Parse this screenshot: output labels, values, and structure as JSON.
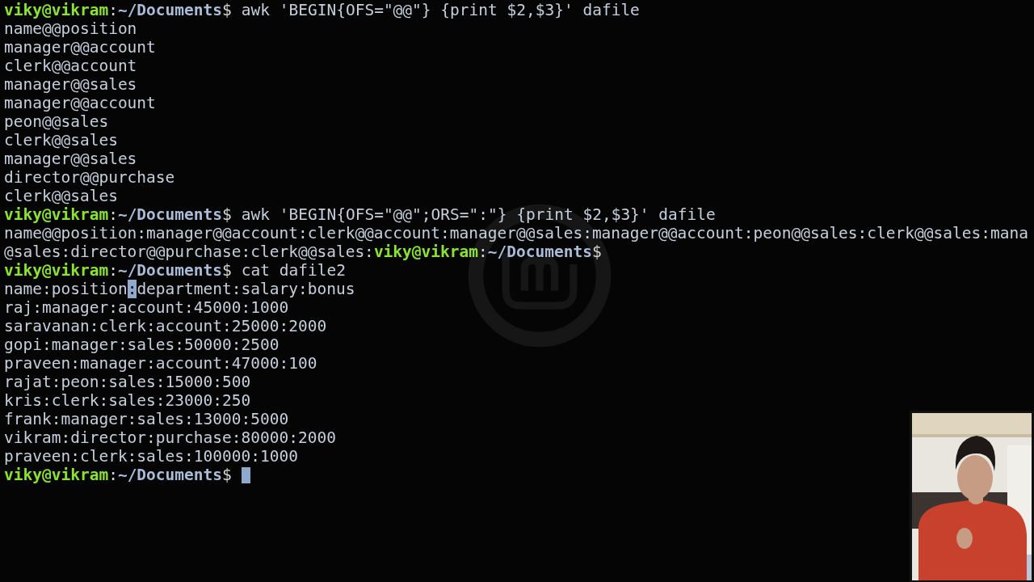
{
  "terminal": {
    "lines": [
      {
        "kind": "command",
        "user": "viky@vikram",
        "colon": ":",
        "path": "~/Documents",
        "symbol": "$",
        "command": "awk 'BEGIN{OFS=\"@@\"} {print $2,$3}' dafile"
      },
      {
        "kind": "output",
        "segments": [
          {
            "text": "name@@position",
            "highlighted": false
          }
        ]
      },
      {
        "kind": "output",
        "segments": [
          {
            "text": "manager@@account",
            "highlighted": false
          }
        ]
      },
      {
        "kind": "output",
        "segments": [
          {
            "text": "clerk@@account",
            "highlighted": false
          }
        ]
      },
      {
        "kind": "output",
        "segments": [
          {
            "text": "manager@@sales",
            "highlighted": false
          }
        ]
      },
      {
        "kind": "output",
        "segments": [
          {
            "text": "manager@@account",
            "highlighted": false
          }
        ]
      },
      {
        "kind": "output",
        "segments": [
          {
            "text": "peon@@sales",
            "highlighted": false
          }
        ]
      },
      {
        "kind": "output",
        "segments": [
          {
            "text": "clerk@@sales",
            "highlighted": false
          }
        ]
      },
      {
        "kind": "output",
        "segments": [
          {
            "text": "manager@@sales",
            "highlighted": false
          }
        ]
      },
      {
        "kind": "output",
        "segments": [
          {
            "text": "director@@purchase",
            "highlighted": false
          }
        ]
      },
      {
        "kind": "output",
        "segments": [
          {
            "text": "clerk@@sales",
            "highlighted": false
          }
        ]
      },
      {
        "kind": "command",
        "user": "viky@vikram",
        "colon": ":",
        "path": "~/Documents",
        "symbol": "$",
        "command": "awk 'BEGIN{OFS=\"@@\";ORS=\":\"} {print $2,$3}' dafile"
      },
      {
        "kind": "output",
        "segments": [
          {
            "text": "name@@position:manager@@account:clerk@@account:manager@@sales:manager@@account:peon@@sales:clerk@@sales:mana",
            "highlighted": false
          }
        ]
      },
      {
        "kind": "output_prompt",
        "output": "@sales:director@@purchase:clerk@@sales:",
        "user": "viky@vikram",
        "colon": ":",
        "path": "~/Documents",
        "symbol": "$"
      },
      {
        "kind": "command",
        "user": "viky@vikram",
        "colon": ":",
        "path": "~/Documents",
        "symbol": "$",
        "command": "cat dafile2"
      },
      {
        "kind": "output",
        "segments": [
          {
            "text": "name:position",
            "highlighted": false
          },
          {
            "text": ":",
            "highlighted": true
          },
          {
            "text": "department:salary:bonus",
            "highlighted": false
          }
        ]
      },
      {
        "kind": "output",
        "segments": [
          {
            "text": "raj:manager:account:45000:1000",
            "highlighted": false
          }
        ]
      },
      {
        "kind": "output",
        "segments": [
          {
            "text": "saravanan:clerk:account:25000:2000",
            "highlighted": false
          }
        ]
      },
      {
        "kind": "output",
        "segments": [
          {
            "text": "gopi:manager:sales:50000:2500",
            "highlighted": false
          }
        ]
      },
      {
        "kind": "output",
        "segments": [
          {
            "text": "praveen:manager:account:47000:100",
            "highlighted": false
          }
        ]
      },
      {
        "kind": "output",
        "segments": [
          {
            "text": "rajat:peon:sales:15000:500",
            "highlighted": false
          }
        ]
      },
      {
        "kind": "output",
        "segments": [
          {
            "text": "kris:clerk:sales:23000:250",
            "highlighted": false
          }
        ]
      },
      {
        "kind": "output",
        "segments": [
          {
            "text": "frank:manager:sales:13000:5000",
            "highlighted": false
          }
        ]
      },
      {
        "kind": "output",
        "segments": [
          {
            "text": "vikram:director:purchase:80000:2000",
            "highlighted": false
          }
        ]
      },
      {
        "kind": "output",
        "segments": [
          {
            "text": "praveen:clerk:sales:100000:1000",
            "highlighted": false
          }
        ]
      },
      {
        "kind": "prompt",
        "user": "viky@vikram",
        "colon": ":",
        "path": "~/Documents",
        "symbol": "$",
        "cursor": true
      }
    ]
  }
}
